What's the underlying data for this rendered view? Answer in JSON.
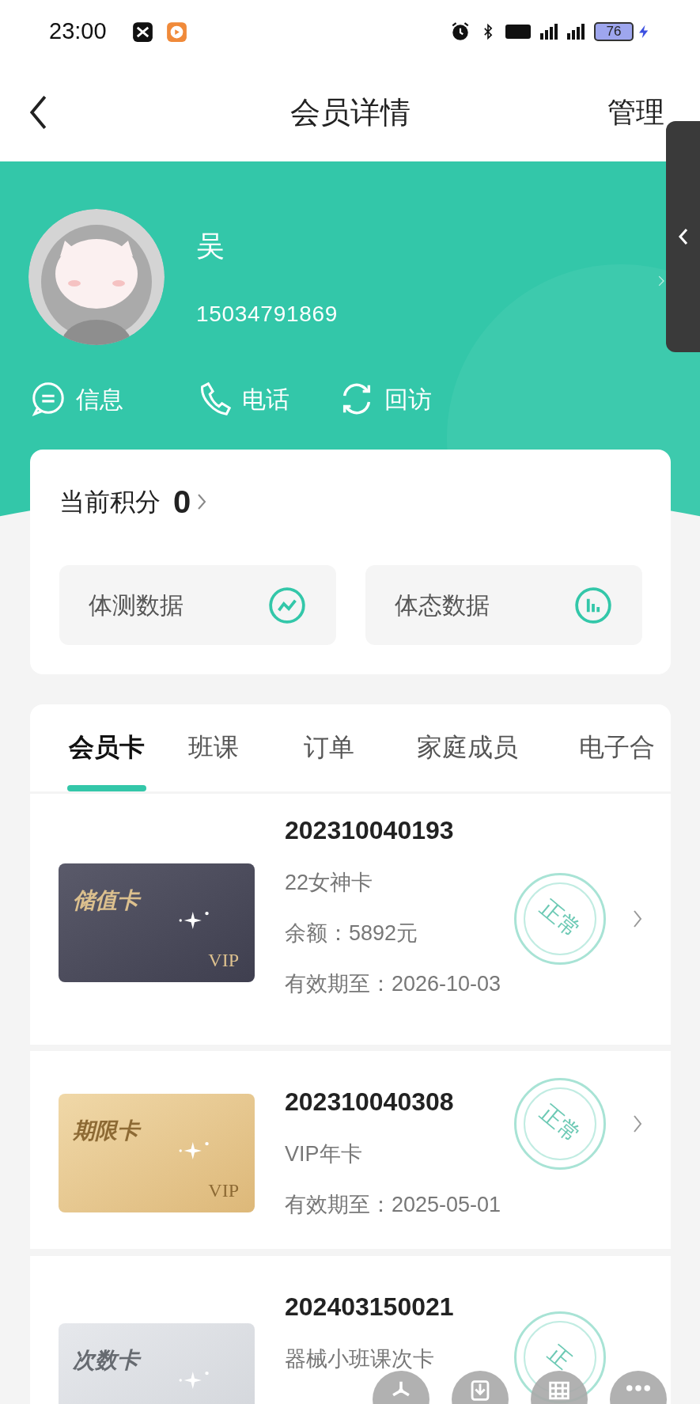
{
  "status_bar": {
    "time": "23:00",
    "battery": "76"
  },
  "header": {
    "title": "会员详情",
    "action": "管理"
  },
  "member": {
    "name": "吴",
    "phone": "15034791869"
  },
  "actions": [
    {
      "label": "信息",
      "kind": "message"
    },
    {
      "label": "电话",
      "kind": "phone"
    },
    {
      "label": "回访",
      "kind": "revisit"
    }
  ],
  "points": {
    "label": "当前积分",
    "value": "0"
  },
  "data_buttons": [
    {
      "label": "体测数据",
      "kind": "trend"
    },
    {
      "label": "体态数据",
      "kind": "bars"
    }
  ],
  "tabs": [
    {
      "label": "会员卡",
      "selected": true
    },
    {
      "label": "班课",
      "selected": false
    },
    {
      "label": "订单",
      "selected": false
    },
    {
      "label": "家庭成员",
      "selected": false
    },
    {
      "label": "电子合",
      "selected": false
    }
  ],
  "cards": [
    {
      "kind": "stored",
      "card_label": "储值卡",
      "badge": "VIP",
      "number": "202310040193",
      "lines": [
        "22女神卡",
        "余额：5892元",
        "有效期至：2026-10-03"
      ],
      "status": "正常"
    },
    {
      "kind": "period",
      "card_label": "期限卡",
      "badge": "VIP",
      "number": "202310040308",
      "lines": [
        "VIP年卡",
        "有效期至：2025-05-01"
      ],
      "status": "正常"
    },
    {
      "kind": "count",
      "card_label": "次数卡",
      "number": "202403150021",
      "lines": [
        "器械小班课次卡"
      ],
      "status": "正"
    }
  ],
  "floating_buttons": [
    {
      "kind": "pinwheel"
    },
    {
      "kind": "download"
    },
    {
      "kind": "grid"
    },
    {
      "kind": "more"
    }
  ]
}
